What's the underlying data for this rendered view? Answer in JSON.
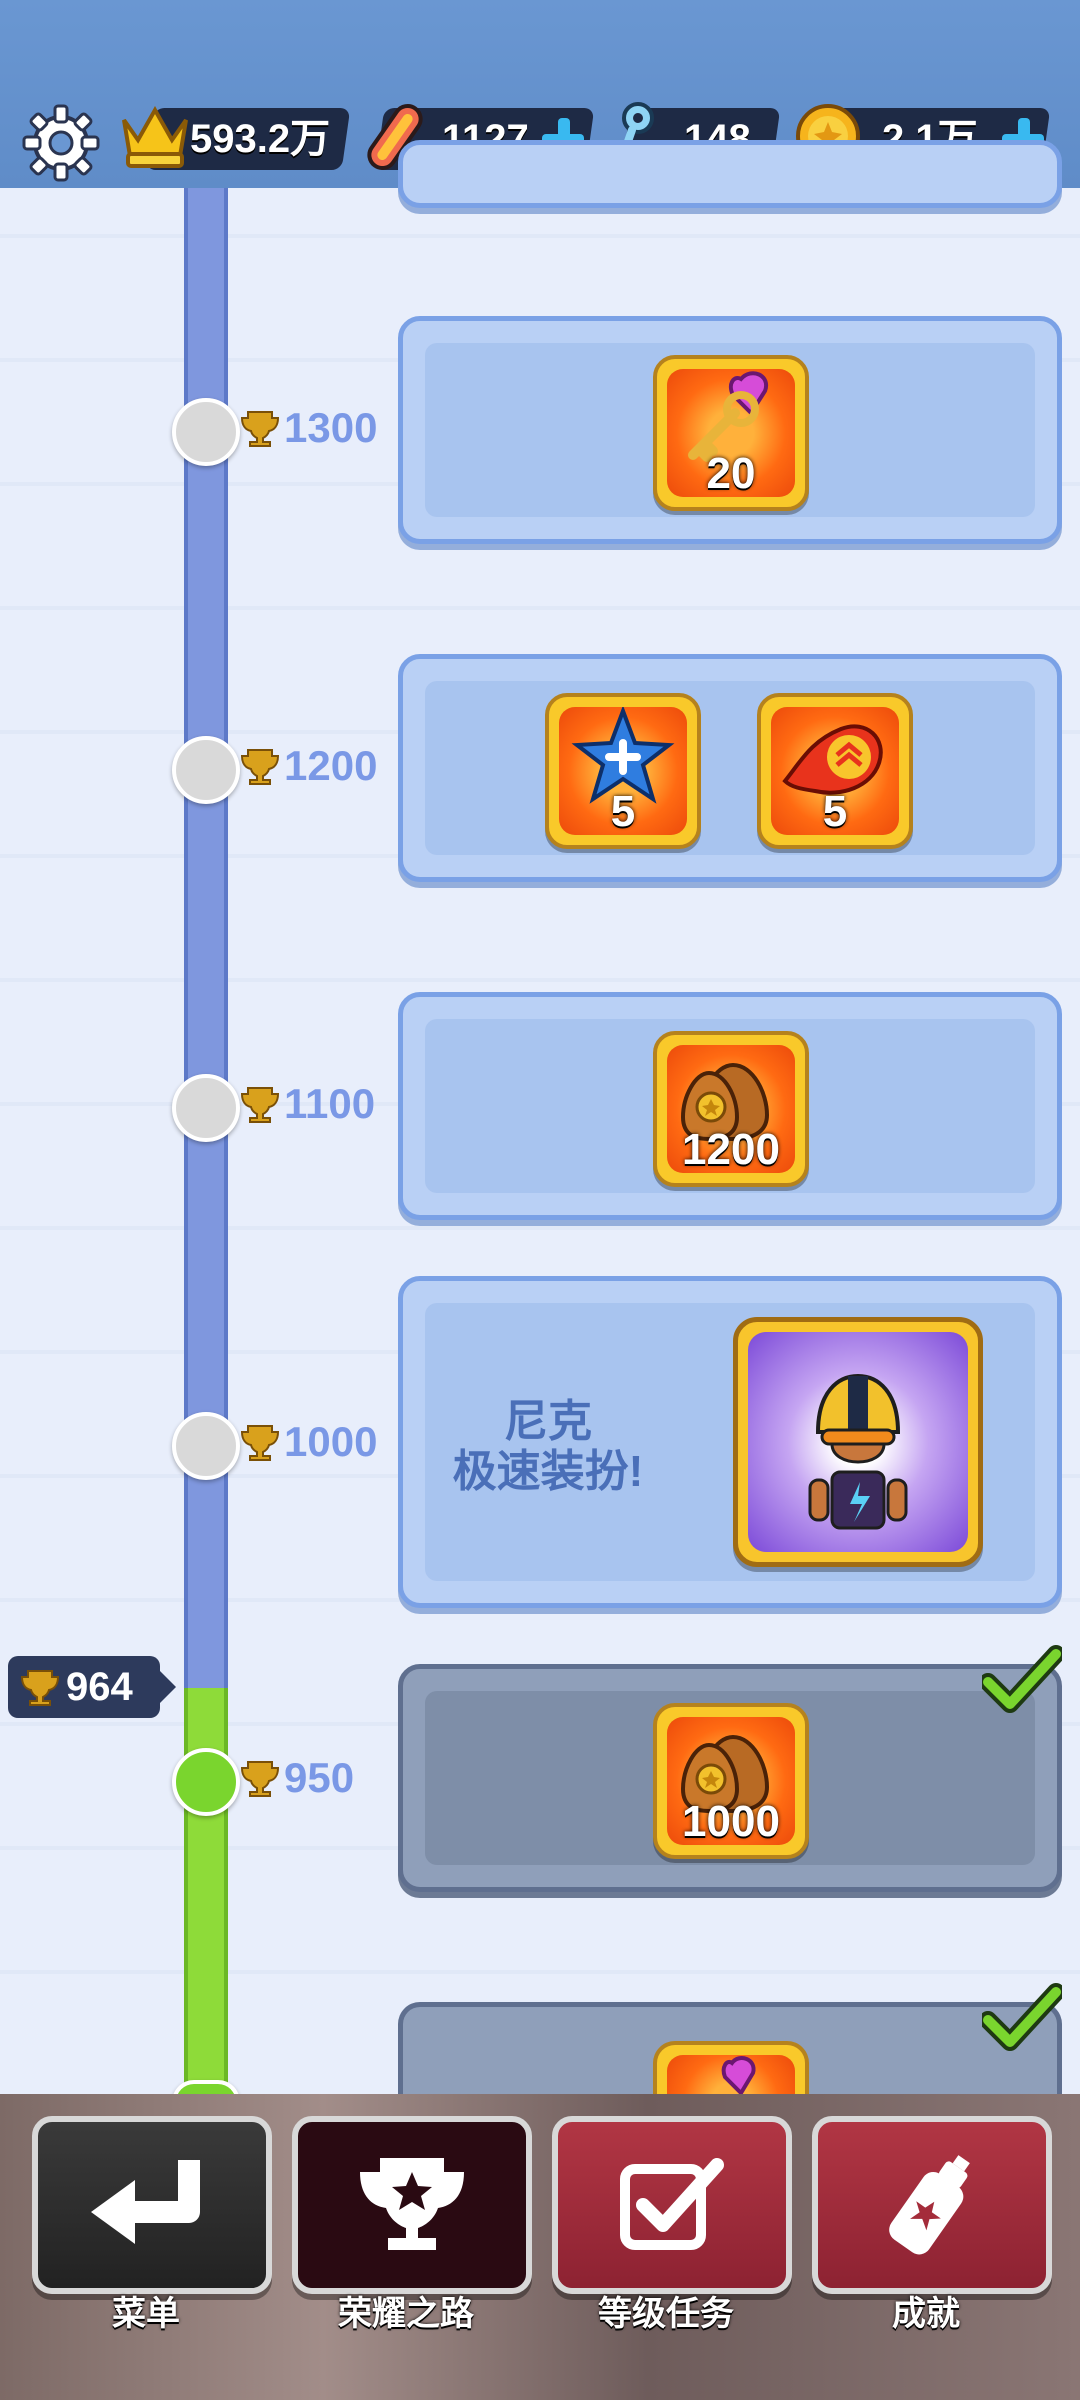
{
  "topbar": {
    "score": "593.2万",
    "boards": "1127",
    "keys": "148",
    "coins": "2.1万"
  },
  "milestones": [
    {
      "value": "1300",
      "reward_qty": "20",
      "reward_icon": "key-heart-icon"
    },
    {
      "value": "1200",
      "rewards": [
        {
          "qty": "5",
          "icon": "star-powerup-icon"
        },
        {
          "qty": "5",
          "icon": "fire-powerup-icon"
        }
      ]
    },
    {
      "value": "1100",
      "reward_qty": "1200",
      "reward_icon": "coin-bag-icon"
    },
    {
      "value": "1000",
      "title_line1": "尼克",
      "title_line2": "极速装扮!",
      "reward_icon": "character-outfit-icon"
    },
    {
      "value": "950",
      "reward_qty": "1000",
      "reward_icon": "coin-bag-icon",
      "claimed": true
    }
  ],
  "current_trophies": "964",
  "nav": {
    "menu": "菜单",
    "glory_road": "荣耀之路",
    "level_tasks": "等级任务",
    "achievements": "成就"
  }
}
